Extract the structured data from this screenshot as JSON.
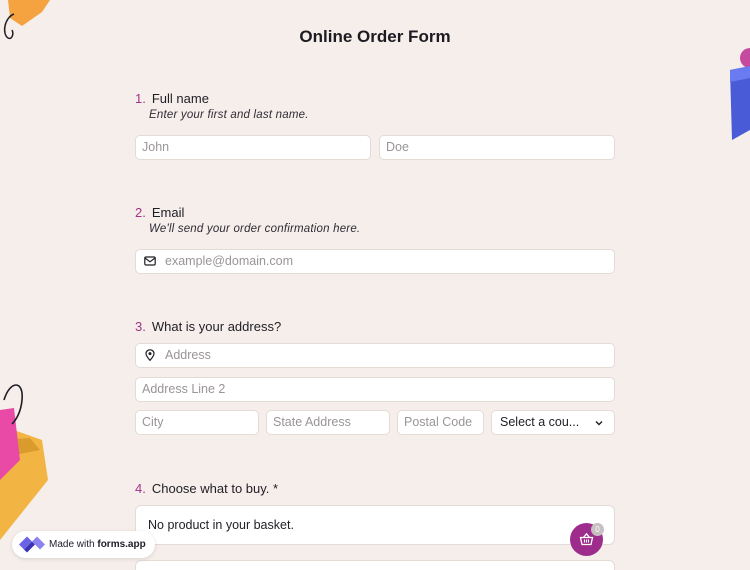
{
  "form": {
    "title": "Online Order Form"
  },
  "questions": {
    "q1": {
      "number": "1.",
      "title": "Full name",
      "description": "Enter your first and last name.",
      "first_placeholder": "John",
      "last_placeholder": "Doe"
    },
    "q2": {
      "number": "2.",
      "title": "Email",
      "description": "We'll send your order confirmation here.",
      "placeholder": "example@domain.com",
      "icon": "envelope-icon"
    },
    "q3": {
      "number": "3.",
      "title": "What is your address?",
      "address_placeholder": "Address",
      "address2_placeholder": "Address Line 2",
      "city_placeholder": "City",
      "state_placeholder": "State Address",
      "postal_placeholder": "Postal Code",
      "country_select": "Select a cou...",
      "icon": "map-pin-icon"
    },
    "q4": {
      "number": "4.",
      "title": "Choose what to buy.",
      "required_mark": "*",
      "basket_text": "No product in your basket."
    }
  },
  "cart": {
    "count": "0",
    "icon": "basket-icon",
    "color": "#9d2c8c"
  },
  "badge": {
    "prefix": "Made with ",
    "brand": "forms.app"
  },
  "colors": {
    "background": "#f5eeea",
    "accent": "#a3328a"
  }
}
